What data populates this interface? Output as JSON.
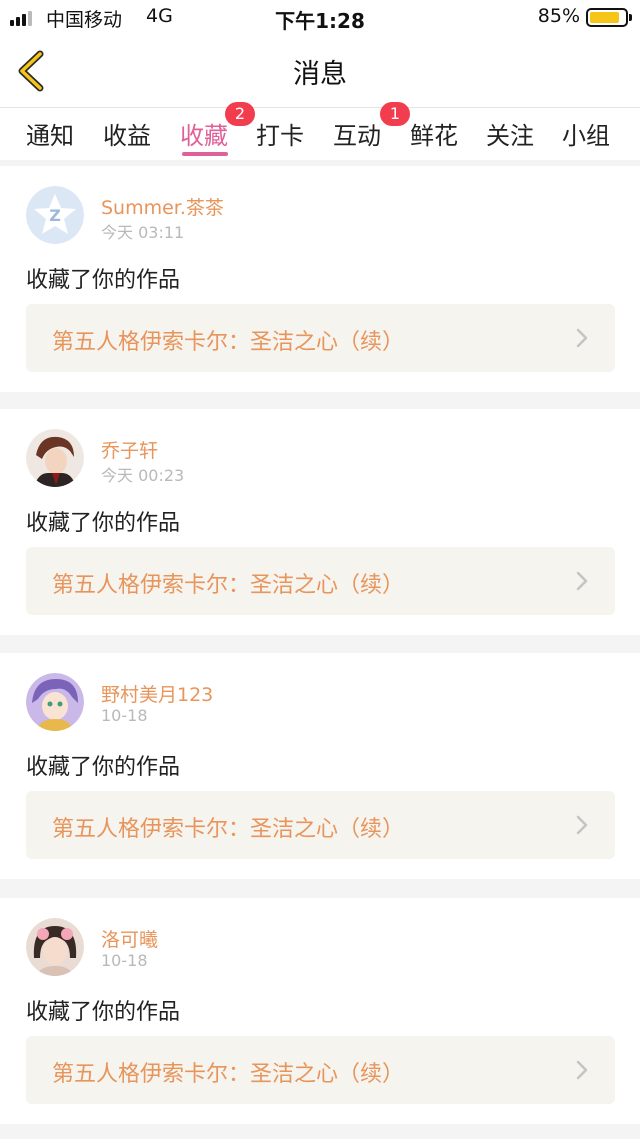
{
  "status_bar": {
    "carrier": "中国移动",
    "network": "4G",
    "time": "下午1:28",
    "battery_percent": "85%",
    "battery_level": 0.85,
    "battery_color": "#f5c518"
  },
  "nav": {
    "title": "消息",
    "back_icon": "chevron-left-icon"
  },
  "colors": {
    "accent": "#e0619a",
    "badge": "#f23d4f",
    "name_orange": "#e8955b"
  },
  "tabs": [
    {
      "label": "通知"
    },
    {
      "label": "收益"
    },
    {
      "label": "收藏",
      "active": true,
      "badge": "2"
    },
    {
      "label": "打卡"
    },
    {
      "label": "互动",
      "badge": "1"
    },
    {
      "label": "鲜花"
    },
    {
      "label": "关注"
    },
    {
      "label": "小组"
    }
  ],
  "messages": [
    {
      "user": "Summer.茶茶",
      "time": "今天 03:11",
      "action": "收藏了你的作品",
      "work": "第五人格伊索卡尔：圣洁之心（续）"
    },
    {
      "user": "乔子轩",
      "time": "今天 00:23",
      "action": "收藏了你的作品",
      "work": "第五人格伊索卡尔：圣洁之心（续）"
    },
    {
      "user": "野村美月123",
      "time": "10-18",
      "action": "收藏了你的作品",
      "work": "第五人格伊索卡尔：圣洁之心（续）"
    },
    {
      "user": "洛可曦",
      "time": "10-18",
      "action": "收藏了你的作品",
      "work": "第五人格伊索卡尔：圣洁之心（续）"
    }
  ]
}
